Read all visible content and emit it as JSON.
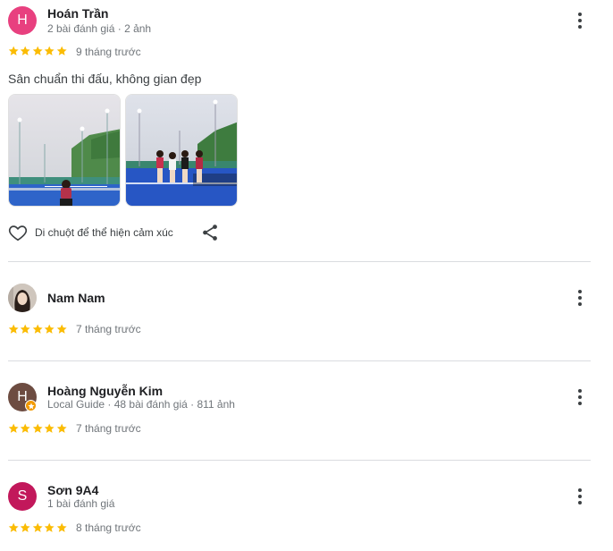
{
  "reviews": [
    {
      "avatar_letter": "H",
      "avatar_color": "#e8407f",
      "name": "Hoán Trần",
      "meta": "2 bài đánh giá · 2 ảnh",
      "rating": 5,
      "time": "9 tháng trước",
      "text": "Sân chuẩn thi đấu, không gian đẹp",
      "reaction_label": "Di chuột để thể hiện cảm xúc"
    },
    {
      "name": "Nam Nam",
      "rating": 5,
      "time": "7 tháng trước"
    },
    {
      "avatar_letter": "H",
      "avatar_color": "#6d4c41",
      "name": "Hoàng Nguyễn Kim",
      "meta": "Local Guide · 48 bài đánh giá · 811 ảnh",
      "rating": 5,
      "time": "7 tháng trước"
    },
    {
      "avatar_letter": "S",
      "avatar_color": "#c2185b",
      "name": "Sơn 9A4",
      "meta": "1 bài đánh giá",
      "rating": 5,
      "time": "8 tháng trước"
    }
  ],
  "colors": {
    "star": "#fbbc04",
    "meta_text": "#70757a",
    "court_blue": "#1e4fc7",
    "divider": "#dadce0",
    "local_guide_badge": "#f29900"
  },
  "icons": [
    "more-vert-icon",
    "heart-outline-icon",
    "share-icon",
    "star-icon",
    "local-guide-badge-icon"
  ]
}
